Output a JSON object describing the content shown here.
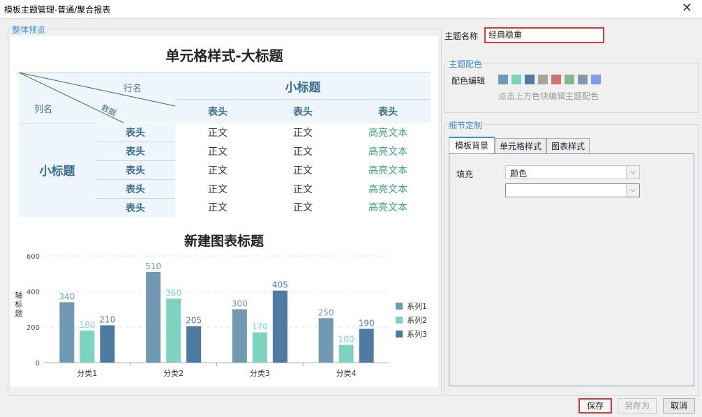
{
  "window": {
    "title": "模板主题管理-普通/聚合报表",
    "close_glyph": "✕"
  },
  "preview": {
    "group_label": "整体预览",
    "big_title": "单元格样式-大标题",
    "table": {
      "corner_row_label": "行名",
      "corner_data_label": "数据",
      "corner_col_label": "列名",
      "sub_title": "小标题",
      "headers": [
        "表头",
        "表头",
        "表头"
      ],
      "left_sub_title": "小标题",
      "row_headers": [
        "表头",
        "表头",
        "表头",
        "表头",
        "表头"
      ],
      "rows": [
        [
          "正文",
          "正文",
          "高亮文本"
        ],
        [
          "正文",
          "正文",
          "高亮文本"
        ],
        [
          "正文",
          "正文",
          "高亮文本"
        ],
        [
          "正文",
          "正文",
          "高亮文本"
        ],
        [
          "正文",
          "正文",
          "高亮文本"
        ]
      ]
    }
  },
  "chart_data": {
    "type": "bar",
    "title": "新建图表标题",
    "ylabel": "轴标题",
    "xlabel": "",
    "categories": [
      "分类1",
      "分类2",
      "分类3",
      "分类4"
    ],
    "series": [
      {
        "name": "系列1",
        "values": [
          340,
          510,
          300,
          250
        ],
        "color": "#7199b3"
      },
      {
        "name": "系列2",
        "values": [
          180,
          360,
          170,
          100
        ],
        "color": "#7dd3c0"
      },
      {
        "name": "系列3",
        "values": [
          210,
          205,
          405,
          190
        ],
        "color": "#4f7ba2"
      }
    ],
    "ylim": [
      0,
      600
    ],
    "yticks": [
      0,
      200,
      400,
      600
    ],
    "grid": true,
    "legend_position": "right"
  },
  "sidebar": {
    "theme_name_label": "主题名称",
    "theme_name_value": "经典稳重",
    "color_group_label": "主题配色",
    "color_edit_label": "配色编辑",
    "palette": [
      "#7199b3",
      "#7dd3c0",
      "#4f7ba2",
      "#a9a39f",
      "#c97373",
      "#86b88a",
      "#7f98b0",
      "#7c9ee8"
    ],
    "palette_hint": "点击上方色块编辑主题配色",
    "detail_group_label": "细节定制",
    "tabs": [
      "模板背景",
      "单元格样式",
      "图表样式"
    ],
    "fill_label": "填充",
    "fill_value": "颜色",
    "color_value": "",
    "dropdown_glyph": "⌵"
  },
  "footer": {
    "save": "保存",
    "save_as": "另存为",
    "cancel": "取消"
  }
}
